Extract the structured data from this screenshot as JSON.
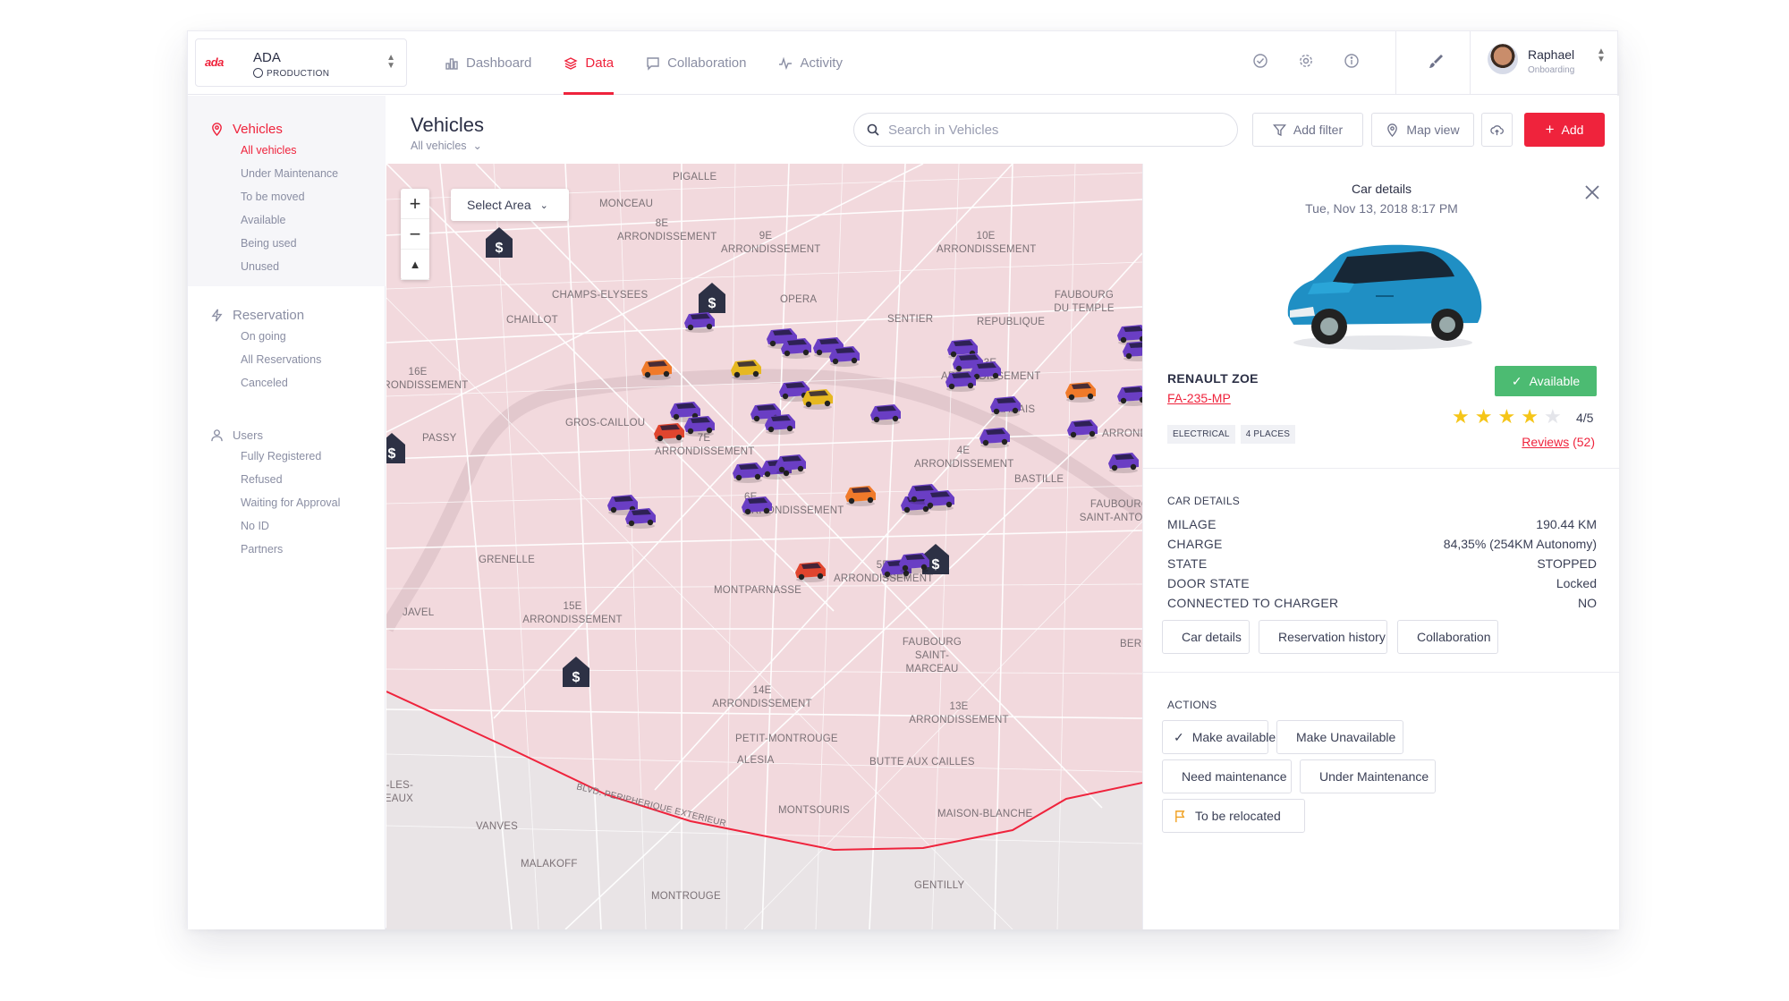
{
  "org": {
    "logo": "ada",
    "name": "ADA",
    "env": "PRODUCTION"
  },
  "nav": {
    "tabs": [
      {
        "label": "Dashboard",
        "icon": "bar-chart-icon",
        "active": false
      },
      {
        "label": "Data",
        "icon": "layers-icon",
        "active": true
      },
      {
        "label": "Collaboration",
        "icon": "chat-icon",
        "active": false
      },
      {
        "label": "Activity",
        "icon": "activity-icon",
        "active": false
      }
    ]
  },
  "user": {
    "name": "Raphael",
    "role": "Onboarding"
  },
  "sidebar": {
    "vehicles": {
      "label": "Vehicles",
      "items": [
        "All vehicles",
        "Under Maintenance",
        "To be moved",
        "Available",
        "Being used",
        "Unused"
      ]
    },
    "reservation": {
      "label": "Reservation",
      "items": [
        "On going",
        "All Reservations",
        "Canceled"
      ]
    },
    "users": {
      "label": "Users",
      "items": [
        "Fully Registered",
        "Refused",
        "Waiting for Approval",
        "No ID",
        "Partners"
      ]
    }
  },
  "page": {
    "title": "Vehicles",
    "subtitle": "All vehicles"
  },
  "search": {
    "placeholder": "Search in Vehicles"
  },
  "toolbar": {
    "filter": "Add filter",
    "mapview": "Map view",
    "add": "Add"
  },
  "map": {
    "select_area": "Select Area",
    "labels": [
      "PIGALLE",
      "MONCEAU",
      "8E ARRONDISSEMENT",
      "9E ARRONDISSEMENT",
      "10E ARRONDISSEMENT",
      "CHAMPS-ELYSEES",
      "OPERA",
      "FAUBOURG DU TEMPLE",
      "CHAILLOT",
      "SENTIER",
      "REPUBLIQUE",
      "16E ARRONDISSEMENT",
      "3E ARRONDISSEMENT",
      "11E ARRONDISSEMENT",
      "GROS-CAILLOU",
      "MARAIS",
      "PASSY",
      "7E ARRONDISSEMENT",
      "4E ARRONDISSEMENT",
      "BASTILLE",
      "6E ARRONDISSEMENT",
      "FAUBOURG SAINT-ANTOINE",
      "GRENELLE",
      "5E ARRONDISSEMENT",
      "MONTPARNASSE",
      "JAVEL",
      "15E ARRONDISSEMENT",
      "FAUBOURG SAINT-MARCEAU",
      "BERCY",
      "14E ARRONDISSEMENT",
      "13E ARRONDISSEMENT",
      "PETIT-MONTROUGE",
      "ALESIA",
      "BUTTE AUX CAILLES",
      "ISSY-LES-MOULINEAUX",
      "MONTSOURIS",
      "MAISON-BLANCHE",
      "VANVES",
      "MALAKOFF",
      "GENTILLY",
      "MONTROUGE",
      "BLVD. PERIPHERIQUE EXTERIEUR"
    ]
  },
  "detail": {
    "title": "Car details",
    "date": "Tue, Nov 13, 2018 8:17 PM",
    "model": "RENAULT ZOE",
    "plate": "FA-235-MP",
    "status": "Available",
    "rating": "4/5",
    "rating_value": 4,
    "tags": [
      "ELECTRICAL",
      "4 PLACES"
    ],
    "reviews_label": "Reviews",
    "reviews_count": "(52)",
    "car_details_title": "CAR DETAILS",
    "fields": [
      {
        "k": "MILAGE",
        "v": "190.44 KM"
      },
      {
        "k": "CHARGE",
        "v": "84,35% (254KM Autonomy)"
      },
      {
        "k": "STATE",
        "v": "STOPPED"
      },
      {
        "k": "DOOR STATE",
        "v": "Locked"
      },
      {
        "k": "CONNECTED TO CHARGER",
        "v": "NO"
      }
    ],
    "tabs": [
      "Car details",
      "Reservation history",
      "Collaboration"
    ],
    "actions_title": "ACTIONS",
    "actions": [
      "Make available",
      "Make Unavailable",
      "Need maintenance",
      "Under Maintenance",
      "To be relocated"
    ]
  },
  "colors": {
    "accent": "#ef233c",
    "available": "#4cbb72",
    "star": "#f5c518",
    "car_purple": "#6a3ec4",
    "car_orange": "#f07a2a",
    "car_yellow": "#e6b820",
    "car_red": "#e0452e",
    "map_zone": "#f2d9dd"
  }
}
